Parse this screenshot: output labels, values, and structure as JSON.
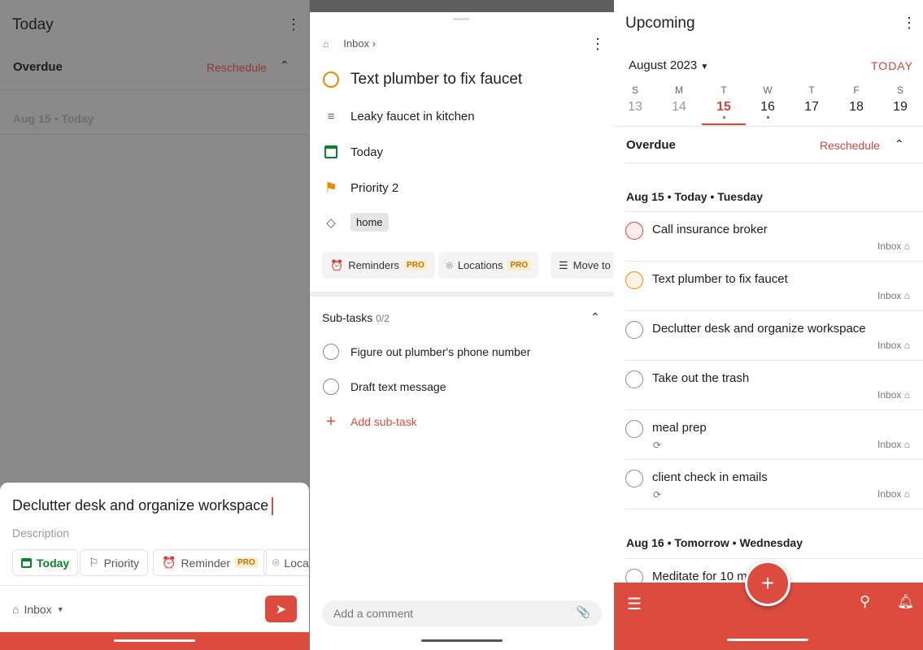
{
  "left": {
    "title": "Today",
    "overdue": "Overdue",
    "reschedule": "Reschedule",
    "date_header": "Aug 15 • Today",
    "quick_add": {
      "task_name": "Declutter desk and organize workspace",
      "description_placeholder": "Description",
      "chips": [
        {
          "label": "Today",
          "icon": "calendar-icon"
        },
        {
          "label": "Priority",
          "icon": "flag-icon"
        },
        {
          "label": "Reminder",
          "icon": "alarm-icon",
          "badge": "PRO"
        },
        {
          "label": "Loca",
          "icon": "location-icon"
        }
      ],
      "project": "Inbox"
    }
  },
  "mid": {
    "breadcrumb": "Inbox",
    "task_title": "Text plumber to fix faucet",
    "description": "Leaky faucet in kitchen",
    "due": "Today",
    "priority": "Priority 2",
    "label": "home",
    "actions": [
      {
        "label": "Reminders",
        "badge": "PRO"
      },
      {
        "label": "Locations",
        "badge": "PRO"
      },
      {
        "label": "Move to"
      }
    ],
    "subtasks_title": "Sub-tasks",
    "subtasks_count": "0/2",
    "subtasks": [
      "Figure out plumber's phone number",
      "Draft text message"
    ],
    "add_subtask": "Add sub-task",
    "comment_placeholder": "Add a comment"
  },
  "right": {
    "title": "Upcoming",
    "month": "August 2023",
    "today_button": "TODAY",
    "days": [
      {
        "l": "S",
        "n": "13"
      },
      {
        "l": "M",
        "n": "14"
      },
      {
        "l": "T",
        "n": "15"
      },
      {
        "l": "W",
        "n": "16"
      },
      {
        "l": "T",
        "n": "17"
      },
      {
        "l": "F",
        "n": "18"
      },
      {
        "l": "S",
        "n": "19"
      }
    ],
    "overdue": "Overdue",
    "reschedule": "Reschedule",
    "section1": "Aug 15 • Today • Tuesday",
    "tasks": [
      {
        "t": "Call insurance broker",
        "p": "Inbox"
      },
      {
        "t": "Text plumber to fix faucet",
        "p": "Inbox"
      },
      {
        "t": "Declutter desk and organize workspace",
        "p": "Inbox"
      },
      {
        "t": "Take out the trash",
        "p": "Inbox"
      },
      {
        "t": "meal prep",
        "p": "Inbox"
      },
      {
        "t": "client check in emails",
        "p": "Inbox"
      }
    ],
    "section2": "Aug 16 • Tomorrow • Wednesday",
    "next_task": "Meditate for 10 m"
  },
  "colors": {
    "accent": "#db4c3f",
    "priority1": "#d1453b",
    "priority2": "#eb8909",
    "green": "#058527"
  }
}
